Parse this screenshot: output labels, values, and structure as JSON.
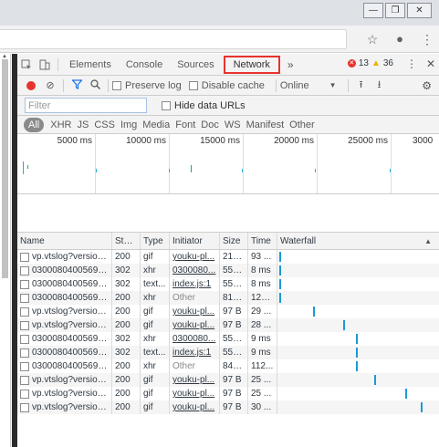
{
  "window": {
    "minimize_glyph": "—",
    "restore_glyph": "❐",
    "close_glyph": "✕"
  },
  "browser": {
    "icons": [
      "star-icon",
      "account-icon",
      "menu-icon"
    ],
    "star_glyph": "☆",
    "account_glyph": "●",
    "menu_glyph": "⋮"
  },
  "devtools": {
    "tabs": [
      "Elements",
      "Console",
      "Sources",
      "Network"
    ],
    "active_tab": "Network",
    "more_tabs": "»",
    "error_count": "13",
    "warning_count": "36",
    "toolbar": {
      "preserve_log": "Preserve log",
      "disable_cache": "Disable cache",
      "throttle": "Online"
    },
    "filter": {
      "placeholder": "Filter",
      "hide_data_urls": "Hide data URLs"
    },
    "types": [
      "All",
      "XHR",
      "JS",
      "CSS",
      "Img",
      "Media",
      "Font",
      "Doc",
      "WS",
      "Manifest",
      "Other"
    ],
    "active_type": "All",
    "overview_ticks": [
      "5000 ms",
      "10000 ms",
      "15000 ms",
      "20000 ms",
      "25000 ms",
      "3000"
    ],
    "columns": {
      "name": "Name",
      "status": "Stat...",
      "type": "Type",
      "initiator": "Initiator",
      "size": "Size",
      "time": "Time",
      "waterfall": "Waterfall"
    },
    "rows": [
      {
        "name": "vp.vtslog?version...",
        "status": "200",
        "type": "gif",
        "initiator": "youku-pl...",
        "initiator_link": true,
        "size": "212 B",
        "time": "93 ...",
        "wf": 0.0
      },
      {
        "name": "03000804005697...",
        "status": "302",
        "type": "xhr",
        "initiator": "0300080...",
        "initiator_link": true,
        "size": "553 B",
        "time": "8 ms",
        "wf": 0.0
      },
      {
        "name": "03000804005697...",
        "status": "302",
        "type": "text...",
        "initiator": "index.js:1",
        "initiator_link": true,
        "size": "553 B",
        "time": "8 ms",
        "wf": 0.0
      },
      {
        "name": "03000804005697...",
        "status": "200",
        "type": "xhr",
        "initiator": "Other",
        "initiator_link": false,
        "size": "815...",
        "time": "121...",
        "wf": 0.0
      },
      {
        "name": "vp.vtslog?version...",
        "status": "200",
        "type": "gif",
        "initiator": "youku-pl...",
        "initiator_link": true,
        "size": "97 B",
        "time": "29 ...",
        "wf": 0.24
      },
      {
        "name": "vp.vtslog?version...",
        "status": "200",
        "type": "gif",
        "initiator": "youku-pl...",
        "initiator_link": true,
        "size": "97 B",
        "time": "28 ...",
        "wf": 0.45
      },
      {
        "name": "03000804005697...",
        "status": "302",
        "type": "xhr",
        "initiator": "0300080...",
        "initiator_link": true,
        "size": "555 B",
        "time": "9 ms",
        "wf": 0.54
      },
      {
        "name": "03000804005697...",
        "status": "302",
        "type": "text...",
        "initiator": "index.js:1",
        "initiator_link": true,
        "size": "555 B",
        "time": "9 ms",
        "wf": 0.54
      },
      {
        "name": "03000804005697...",
        "status": "200",
        "type": "xhr",
        "initiator": "Other",
        "initiator_link": false,
        "size": "848...",
        "time": "112...",
        "wf": 0.54
      },
      {
        "name": "vp.vtslog?version...",
        "status": "200",
        "type": "gif",
        "initiator": "youku-pl...",
        "initiator_link": true,
        "size": "97 B",
        "time": "25 ...",
        "wf": 0.67
      },
      {
        "name": "vp.vtslog?version...",
        "status": "200",
        "type": "gif",
        "initiator": "youku-pl...",
        "initiator_link": true,
        "size": "97 B",
        "time": "25 ...",
        "wf": 0.89
      },
      {
        "name": "vp.vtslog?version...",
        "status": "200",
        "type": "gif",
        "initiator": "youku-pl...",
        "initiator_link": true,
        "size": "97 B",
        "time": "30 ...",
        "wf": 1.0
      }
    ]
  }
}
